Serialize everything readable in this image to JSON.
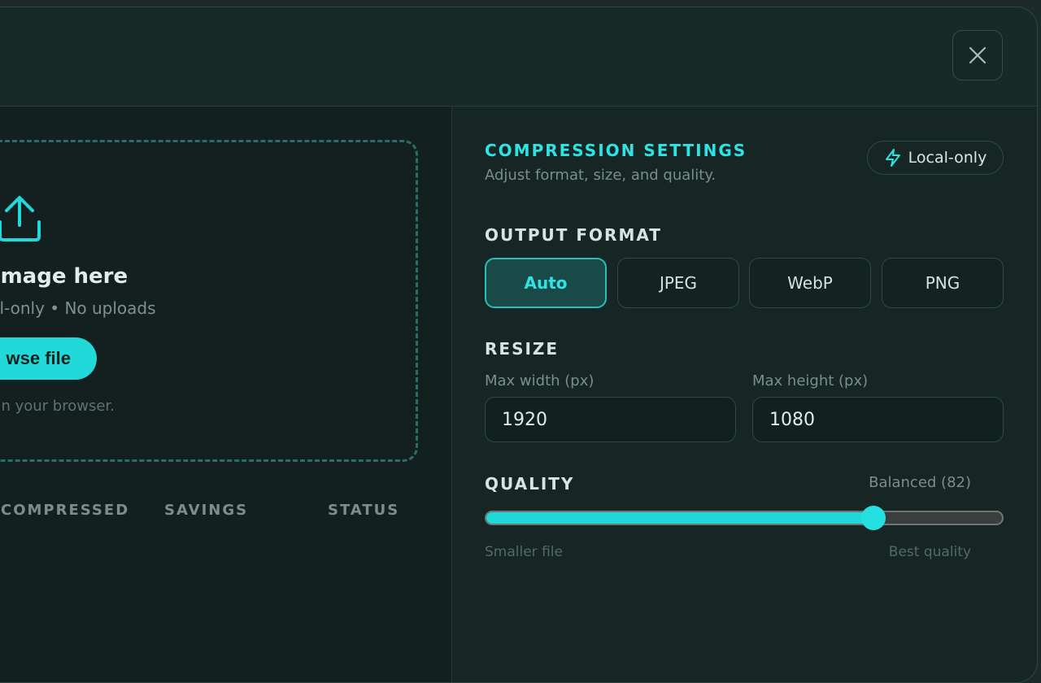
{
  "dropzone": {
    "title": "p image here",
    "subtitle": "ocal-only • No uploads",
    "browse_label": "wse file",
    "note": "ely in your browser."
  },
  "table": {
    "columns": [
      "COMPRESSED",
      "SAVINGS",
      "STATUS"
    ]
  },
  "settings": {
    "title": "COMPRESSION SETTINGS",
    "subtitle": "Adjust format, size, and quality.",
    "badge": "Local-only",
    "output_format": {
      "label": "OUTPUT FORMAT",
      "options": [
        "Auto",
        "JPEG",
        "WebP",
        "PNG"
      ],
      "selected": "Auto"
    },
    "resize": {
      "label": "RESIZE",
      "max_width_label": "Max width (px)",
      "max_width_value": "1920",
      "max_height_label": "Max height (px)",
      "max_height_value": "1080"
    },
    "quality": {
      "label": "QUALITY",
      "value_text": "Balanced (82)",
      "value_fraction": 0.75,
      "min_caption": "Smaller file",
      "max_caption": "Best quality"
    }
  },
  "colors": {
    "accent": "#22d9d9",
    "background": "#152624"
  },
  "icons": {
    "close": "close-icon",
    "upload": "upload-icon",
    "badge": "lightning-icon"
  }
}
